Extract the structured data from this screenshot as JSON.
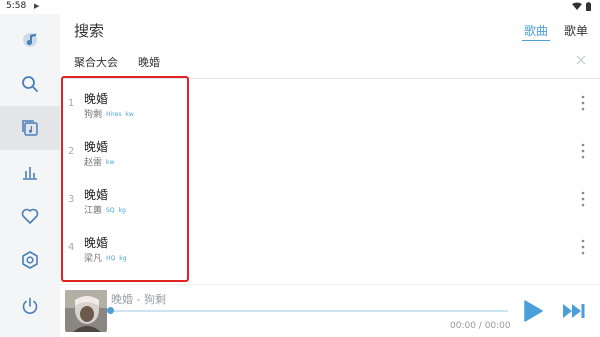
{
  "status_bar": {
    "time": "5:58"
  },
  "header": {
    "title": "搜索",
    "tabs": [
      {
        "label": "歌曲",
        "active": true
      },
      {
        "label": "歌单",
        "active": false
      }
    ]
  },
  "search": {
    "source": "聚合大会",
    "query": "晚婚"
  },
  "sidebar": {
    "items": [
      {
        "icon": "music-note-icon",
        "active": false
      },
      {
        "icon": "search-icon",
        "active": false
      },
      {
        "icon": "song-list-icon",
        "active": true
      },
      {
        "icon": "leaderboard-icon",
        "active": false
      },
      {
        "icon": "heart-icon",
        "active": false
      },
      {
        "icon": "settings-icon",
        "active": false
      },
      {
        "icon": "power-icon",
        "active": false
      }
    ]
  },
  "results": [
    {
      "num": "1",
      "title": "晚婚",
      "singer": "狗剩",
      "quality": "Hires",
      "source": "kw"
    },
    {
      "num": "2",
      "title": "晚婚",
      "singer": "赵雷",
      "quality": "",
      "source": "kw"
    },
    {
      "num": "3",
      "title": "晚婚",
      "singer": "江蕙",
      "quality": "SQ",
      "source": "kg"
    },
    {
      "num": "4",
      "title": "晚婚",
      "singer": "梁凡",
      "quality": "HQ",
      "source": "kg"
    }
  ],
  "player": {
    "now_playing": "晚婚 - 狗剩",
    "time": "00:00 / 00:00",
    "progress": 0
  },
  "colors": {
    "accent": "#4a9ed9",
    "highlight": "#e02424",
    "sidebar_bg": "#f4f5f7"
  }
}
